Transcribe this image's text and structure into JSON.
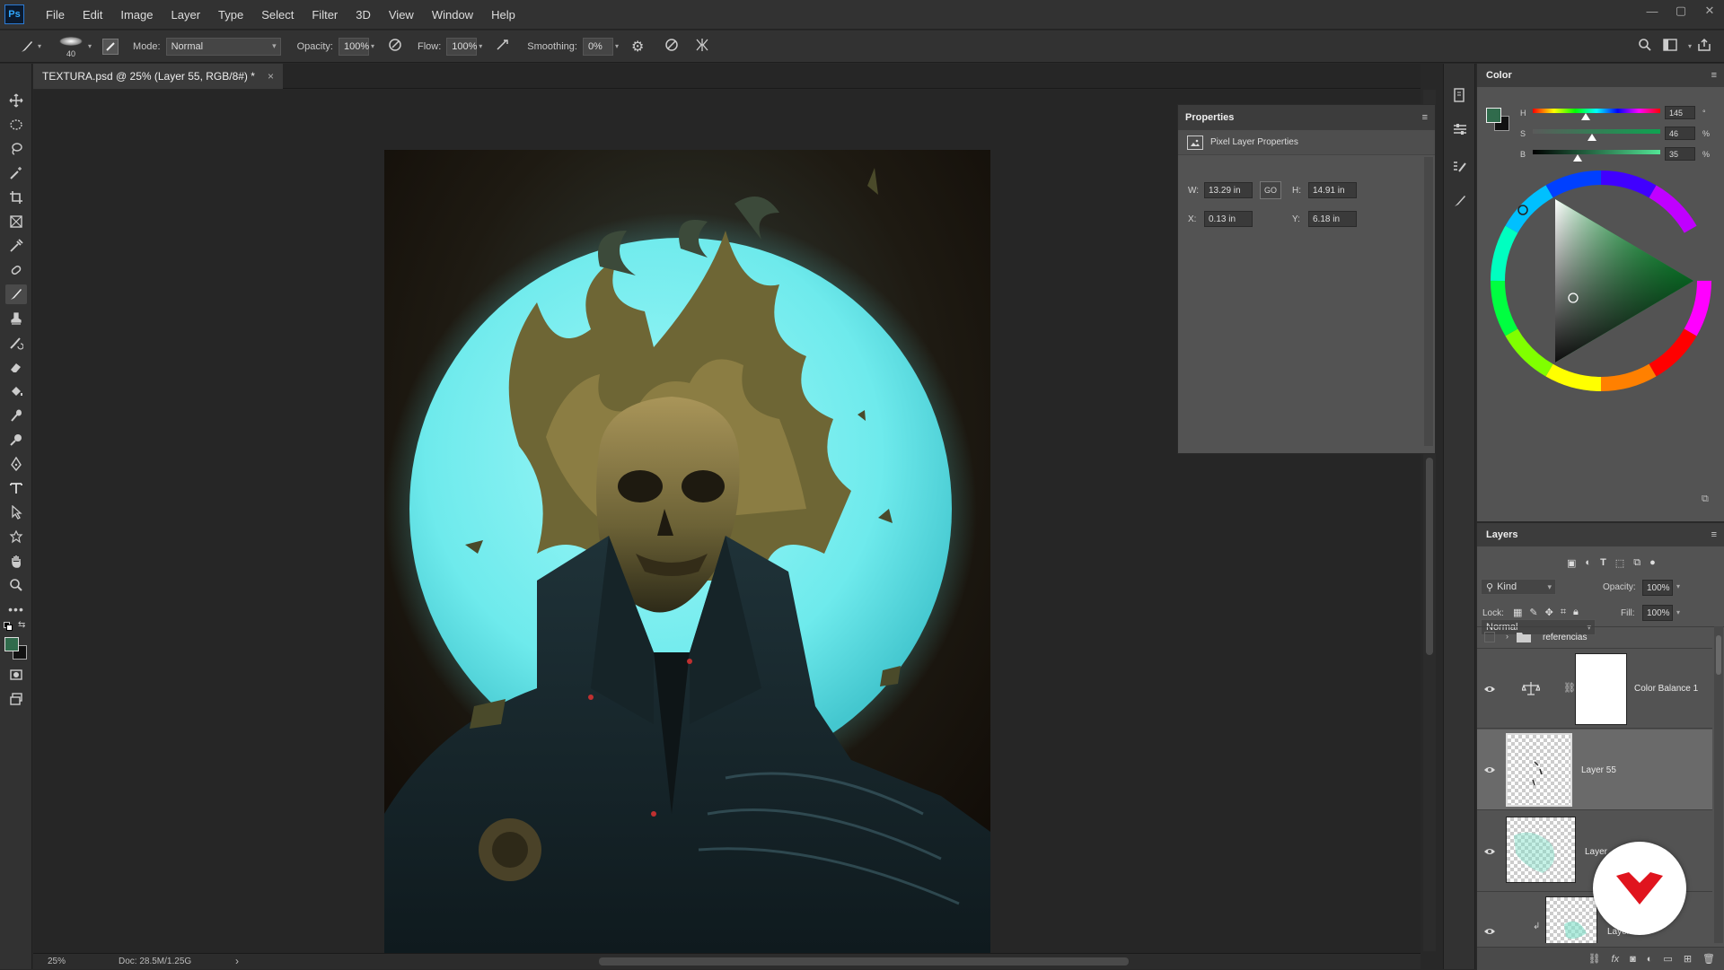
{
  "menu": [
    "File",
    "Edit",
    "Image",
    "Layer",
    "Type",
    "Select",
    "Filter",
    "3D",
    "View",
    "Window",
    "Help"
  ],
  "app_logo": "Ps",
  "options": {
    "brush_size": "40",
    "mode_label": "Mode:",
    "mode_value": "Normal",
    "opacity_label": "Opacity:",
    "opacity_value": "100%",
    "flow_label": "Flow:",
    "flow_value": "100%",
    "smoothing_label": "Smoothing:",
    "smoothing_value": "0%"
  },
  "document": {
    "tab_title": "TEXTURA.psd @ 25% (Layer 55, RGB/8#) *",
    "close": "×"
  },
  "status": {
    "zoom": "25%",
    "doc_size": "Doc: 28.5M/1.25G",
    "arrow": "›"
  },
  "properties": {
    "title": "Properties",
    "subtitle": "Pixel Layer Properties",
    "w_label": "W:",
    "w_value": "13.29 in",
    "link_label": "GO",
    "h_label": "H:",
    "h_value": "14.91 in",
    "x_label": "X:",
    "x_value": "0.13 in",
    "y_label": "Y:",
    "y_value": "6.18 in"
  },
  "color": {
    "title": "Color",
    "h_label": "H",
    "h_value": "145",
    "h_unit": "°",
    "s_label": "S",
    "s_value": "46",
    "s_unit": "%",
    "b_label": "B",
    "b_value": "35",
    "b_unit": "%",
    "foreground": "#306b4c",
    "background": "#111111"
  },
  "layers": {
    "title": "Layers",
    "kind_label": "Kind",
    "blend_mode": "Normal",
    "opacity_label": "Opacity:",
    "opacity_value": "100%",
    "lock_label": "Lock:",
    "fill_label": "Fill:",
    "fill_value": "100%",
    "items": [
      {
        "name": "referencias",
        "type": "group"
      },
      {
        "name": "Color Balance 1",
        "type": "adjustment"
      },
      {
        "name": "Layer 55",
        "type": "pixel",
        "selected": true
      },
      {
        "name": "Layer",
        "type": "pixel"
      },
      {
        "name": "Layer 50",
        "type": "pixel"
      }
    ]
  },
  "accent_colors": {
    "selection": "#6a6a6a",
    "logo_red": "#e0141e",
    "moon": "#7ff0f0"
  }
}
